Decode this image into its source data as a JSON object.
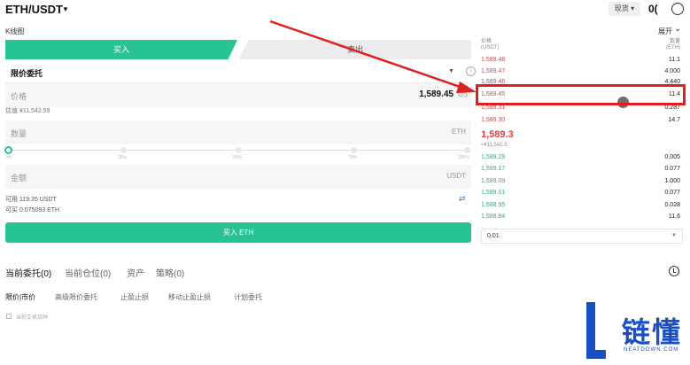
{
  "header": {
    "pair": "ETH/USDT",
    "spot_label": "现货",
    "truncated_text": "0("
  },
  "kline_label": "K线图",
  "expand_label": "展开",
  "trade_tabs": {
    "buy": "买入",
    "sell": "卖出"
  },
  "order_type": "限价委托",
  "price_field": {
    "label": "价格",
    "value": "1,589.45",
    "unit": "US"
  },
  "estimate": "估值 ¥11,542.59",
  "amount_field": {
    "label": "数量",
    "unit": "ETH"
  },
  "slider": {
    "value_fraction": 0,
    "ticks": [
      "0%",
      "25%",
      "50%",
      "75%",
      "100%"
    ]
  },
  "total_field": {
    "label": "金额",
    "unit": "USDT"
  },
  "balance": {
    "available": "可用 119.35 USDT",
    "can_buy": "可买 0.075093 ETH"
  },
  "buy_button": "买入 ETH",
  "orderbook": {
    "price_header": "价格\n(USDT)",
    "qty_header": "数量\n(ETH)",
    "asks": [
      {
        "price": "1,589.48",
        "qty": "11.1"
      },
      {
        "price": "1,589.47",
        "qty": "4.000"
      },
      {
        "price": "1,589.46",
        "qty": "4.440"
      },
      {
        "price": "1,589.45",
        "qty": "11.4"
      },
      {
        "price": "1,589.31",
        "qty": "0.287"
      },
      {
        "price": "1,589.30",
        "qty": "14.7"
      }
    ],
    "last_price": "1,589.3",
    "last_cny": "≈¥11,541.5",
    "bids": [
      {
        "price": "1,589.29",
        "qty": "0.005"
      },
      {
        "price": "1,589.17",
        "qty": "0.077"
      },
      {
        "price": "1,589.09",
        "qty": "1.000"
      },
      {
        "price": "1,589.01",
        "qty": "0.077"
      },
      {
        "price": "1,588.95",
        "qty": "0.028"
      },
      {
        "price": "1,588.94",
        "qty": "11.6"
      }
    ],
    "depth": "0.01"
  },
  "bottom_tabs": [
    {
      "label": "当前委托(0)",
      "active": true
    },
    {
      "label": "当前仓位(0)",
      "active": false
    },
    {
      "label": "资产",
      "active": false
    },
    {
      "label": "策略(0)",
      "active": false
    }
  ],
  "sub_tabs": [
    {
      "label": "限价|市价",
      "active": true
    },
    {
      "label": "高级限价委托",
      "active": false
    },
    {
      "label": "止盈止损",
      "active": false
    },
    {
      "label": "移动止盈止损",
      "active": false
    },
    {
      "label": "计划委托",
      "active": false
    }
  ],
  "show_pair_only": "当前交易品种",
  "watermark": {
    "text": "链懂",
    "sub": "NEATDOWN.COM"
  },
  "colors": {
    "buy": "#28c392",
    "ask": "#d64545",
    "bid": "#28b087",
    "annotation": "#e02020",
    "watermark": "#1a4fc2"
  }
}
